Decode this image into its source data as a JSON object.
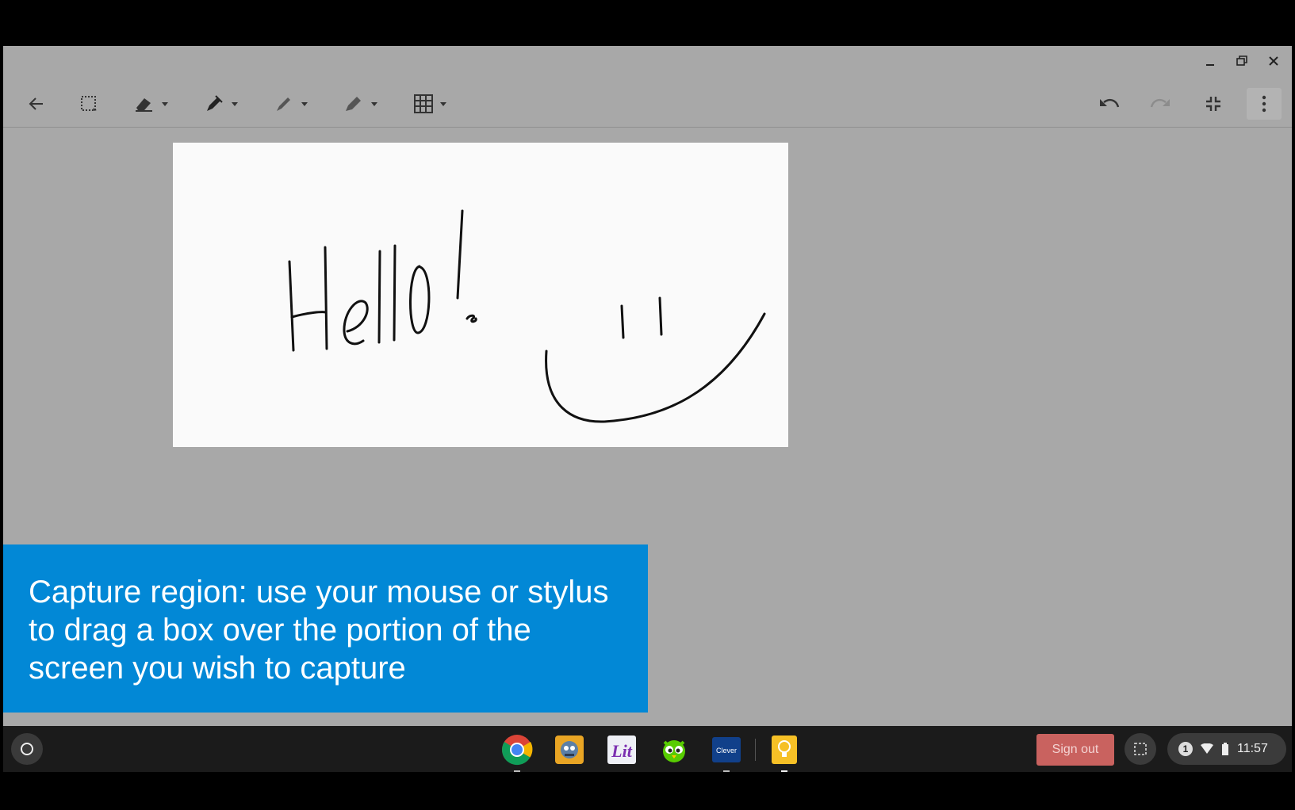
{
  "window": {
    "controls": {
      "minimize_icon": "minimize-icon",
      "restore_icon": "restore-icon",
      "close_icon": "close-icon"
    }
  },
  "toolbar": {
    "tools": [
      {
        "name": "back",
        "icon": "arrow-left-icon"
      },
      {
        "name": "lasso-select",
        "icon": "lasso-select-icon"
      },
      {
        "name": "eraser",
        "icon": "eraser-icon",
        "has_dropdown": true
      },
      {
        "name": "pen",
        "icon": "pen-icon",
        "has_dropdown": true
      },
      {
        "name": "marker",
        "icon": "marker-icon",
        "has_dropdown": true
      },
      {
        "name": "highlighter",
        "icon": "highlighter-icon",
        "has_dropdown": true
      },
      {
        "name": "background-grid",
        "icon": "grid-icon",
        "has_dropdown": true
      }
    ],
    "right": [
      {
        "name": "undo",
        "icon": "undo-icon"
      },
      {
        "name": "redo",
        "icon": "redo-icon"
      },
      {
        "name": "exit-fullscreen",
        "icon": "collapse-icon"
      },
      {
        "name": "more",
        "icon": "more-vertical-icon"
      }
    ]
  },
  "canvas": {
    "handwriting": "Hello!",
    "background": "#fafafa",
    "ink_color": "#111111"
  },
  "banner": {
    "text": "Capture region: use your mouse or stylus to drag a box over the portion of the screen you wish to capture",
    "color": "#0288d6"
  },
  "shelf": {
    "apps": [
      {
        "name": "Chrome",
        "icon": "chrome-icon"
      },
      {
        "name": "Robot app",
        "icon": "robot-icon"
      },
      {
        "name": "Lit",
        "icon": "lit-icon",
        "label": "Lit"
      },
      {
        "name": "Duolingo",
        "icon": "owl-icon"
      },
      {
        "name": "Clever",
        "icon": "clever-icon",
        "label": "Clever"
      },
      {
        "name": "Keep",
        "icon": "lightbulb-icon"
      }
    ],
    "sign_out_label": "Sign out",
    "notification_count": "1",
    "time": "11:57"
  }
}
